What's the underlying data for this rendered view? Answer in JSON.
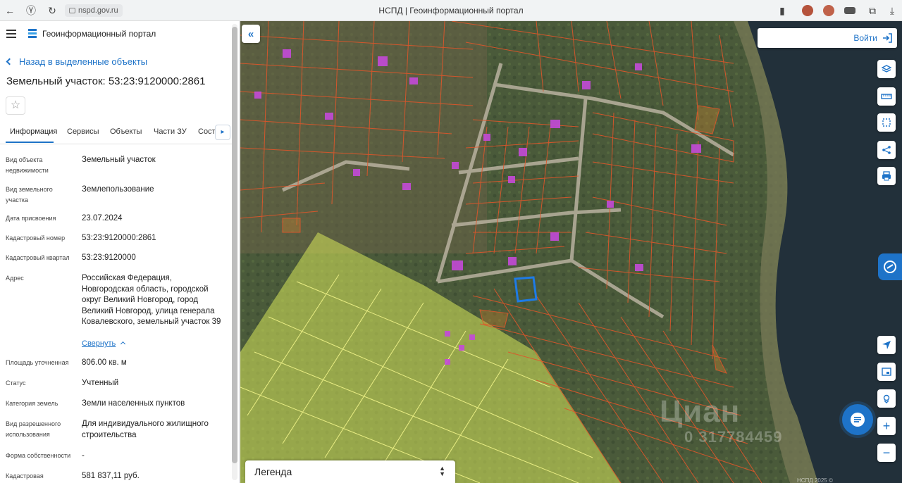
{
  "browser": {
    "url": "nspd.gov.ru",
    "title": "НСПД | Геоинформационный портал"
  },
  "panel": {
    "portal_name": "Геоинформационный портал",
    "back_label": "Назад в выделенные объекты",
    "object_title": "Земельный участок: 53:23:9120000:2861",
    "tabs": [
      "Информация",
      "Сервисы",
      "Объекты",
      "Части ЗУ",
      "Соста"
    ],
    "active_tab": "Информация",
    "fields": [
      {
        "key": "Вид объекта недвижимости",
        "value": "Земельный участок"
      },
      {
        "key": "Вид земельного участка",
        "value": "Землепользование"
      },
      {
        "key": "Дата присвоения",
        "value": "23.07.2024"
      },
      {
        "key": "Кадастровый номер",
        "value": "53:23:9120000:2861"
      },
      {
        "key": "Кадастровый квартал",
        "value": "53:23:9120000"
      },
      {
        "key": "Адрес",
        "value": "Российская Федерация, Новгородская область, городской округ Великий Новгород, город Великий Новгород, улица генерала Ковалевского, земельный участок 39"
      },
      {
        "key": "Площадь уточненная",
        "value": "806.00 кв. м"
      },
      {
        "key": "Статус",
        "value": "Учтенный"
      },
      {
        "key": "Категория земель",
        "value": "Земли населенных пунктов"
      },
      {
        "key": "Вид разрешенного использования",
        "value": "Для индивидуального жилищного строительства"
      },
      {
        "key": "Форма собственности",
        "value": "-"
      },
      {
        "key": "Кадастровая",
        "value": "581 837,11 руб."
      }
    ],
    "collapse_label": "Свернуть"
  },
  "map": {
    "login_label": "Войти",
    "legend_label": "Легенда",
    "watermark": "Циан",
    "watermark_phone": "0 317784459",
    "attribution": "НСПД 2025 ©",
    "colors": {
      "parcel_outline": "#e0562a",
      "selected_parcel": "#1e7be6",
      "zone_fill": "#d7e85a",
      "building": "#c44ad8",
      "water": "#22303a"
    }
  }
}
